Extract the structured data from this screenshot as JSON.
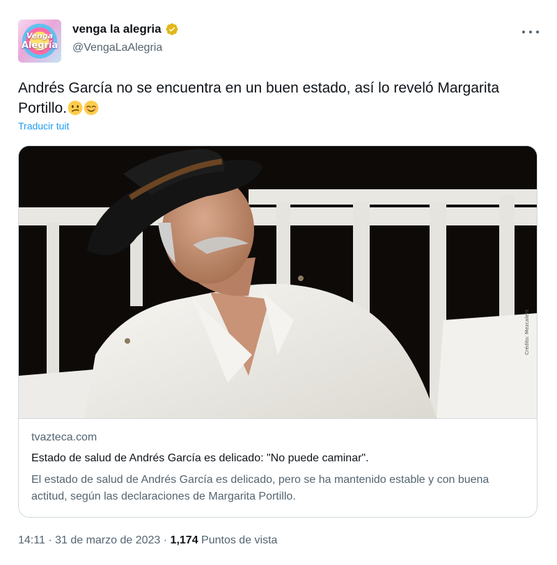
{
  "account": {
    "display_name": "venga la alegria",
    "handle": "@VengaLaAlegria",
    "avatar_text_line1": "Venga",
    "avatar_text_line2": "Alegría",
    "verified_color": "#e2b719"
  },
  "tweet": {
    "text": "Andrés García no se encuentra en un buen estado, así lo reveló Margarita Portillo.",
    "emojis": [
      "confused-face-emoji",
      "relieved-face-emoji"
    ],
    "translate_label": "Traducir tuit"
  },
  "card": {
    "image_credit": "Crédito: Mezcalent",
    "domain": "tvazteca.com",
    "title": "Estado de salud de Andrés García es delicado: \"No puede caminar\".",
    "description": "El estado de salud de Andrés García es delicado, pero se ha mantenido estable y con buena actitud, según las declaraciones de Margarita Portillo."
  },
  "meta": {
    "time": "14:11",
    "separator": "·",
    "date": "31 de marzo de 2023",
    "views_count": "1,174",
    "views_label": "Puntos de vista"
  },
  "colors": {
    "accent": "#1d9bf0",
    "text_primary": "#0f1419",
    "text_secondary": "#536471",
    "border": "#cfd9de"
  }
}
